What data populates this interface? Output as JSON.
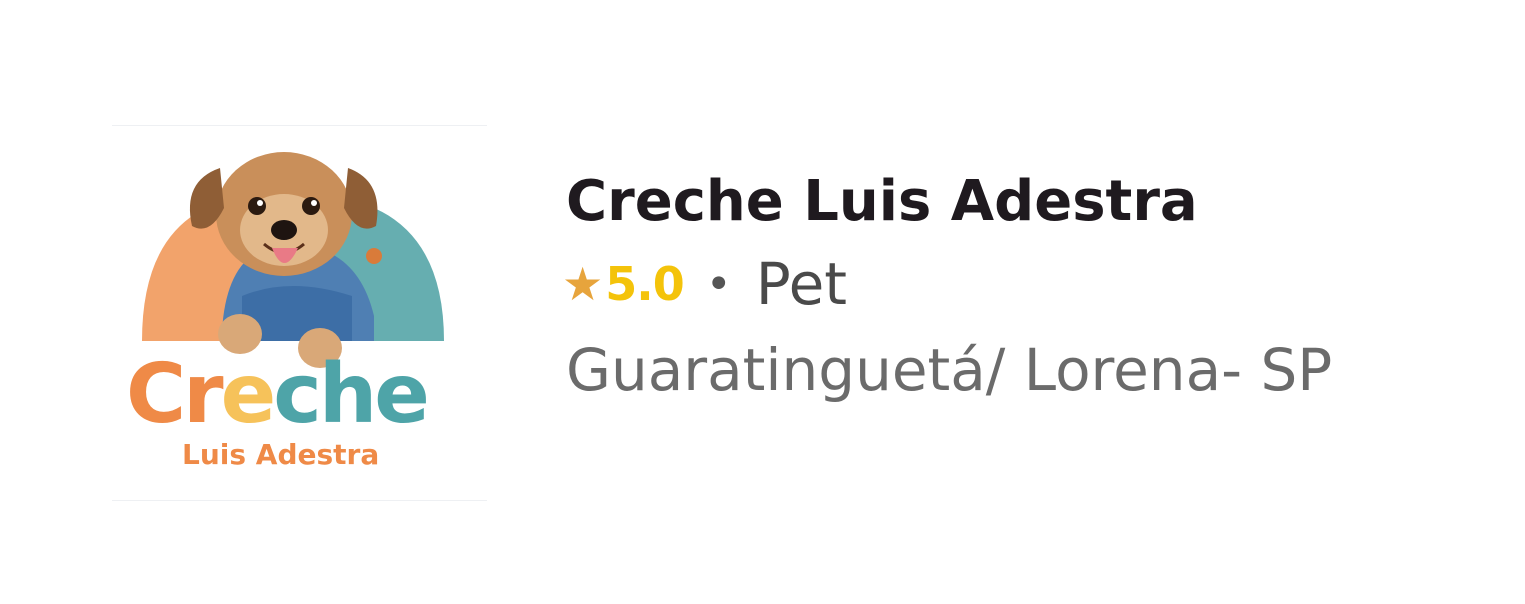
{
  "business": {
    "name": "Creche Luis Adestra",
    "rating": "5.0",
    "separator": "•",
    "category": "Pet",
    "location": "Guaratinguetá/ Lorena- SP"
  },
  "logo": {
    "wordmark": "Creche",
    "subtitle": "Luis Adestra",
    "colors": {
      "orange": "#ef8a47",
      "yellow": "#f6c25a",
      "teal": "#4ea4a8",
      "arch_orange": "#f2a36b",
      "arch_teal": "#66aeb0"
    }
  },
  "icons": {
    "rating": "star-icon"
  },
  "colors": {
    "star": "#e7a43c",
    "rating_text": "#f4c30a",
    "title": "#1f1a1f",
    "location": "#6b6b6b"
  }
}
